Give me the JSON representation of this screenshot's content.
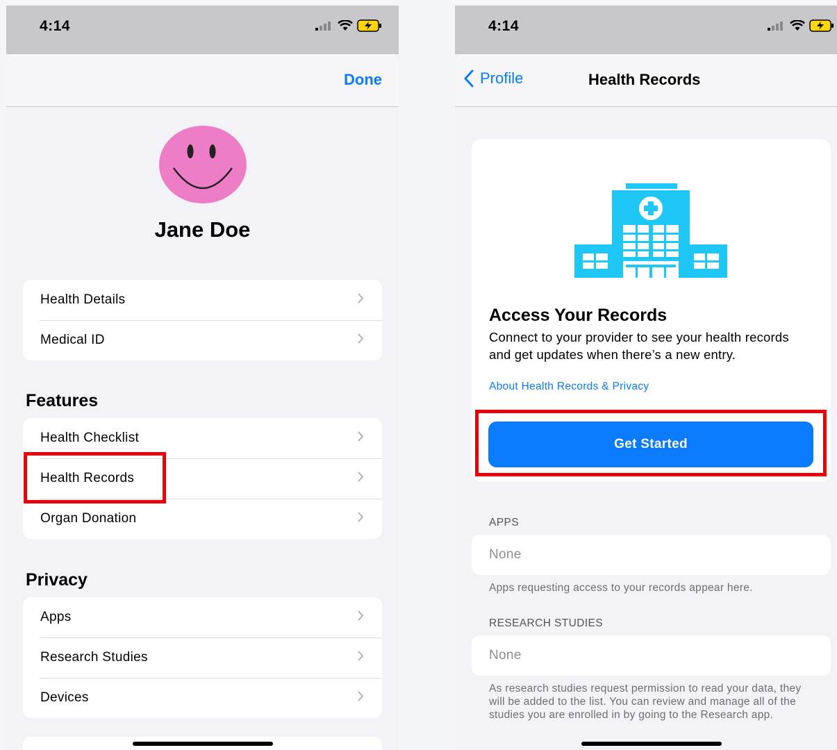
{
  "left": {
    "status": {
      "time": "4:14"
    },
    "nav": {
      "done_label": "Done"
    },
    "profile": {
      "name": "Jane Doe"
    },
    "group1": [
      "Health Details",
      "Medical ID"
    ],
    "features": {
      "title": "Features",
      "items": [
        "Health Checklist",
        "Health Records",
        "Organ Donation"
      ]
    },
    "privacy": {
      "title": "Privacy",
      "items": [
        "Apps",
        "Research Studies",
        "Devices"
      ]
    }
  },
  "right": {
    "status": {
      "time": "4:14"
    },
    "nav": {
      "back_label": "Profile",
      "title": "Health Records"
    },
    "card": {
      "title": "Access Your Records",
      "body": "Connect to your provider to see your health records and get updates when there’s a new entry.",
      "link": "About Health Records & Privacy",
      "button": "Get Started"
    },
    "apps": {
      "header": "APPS",
      "value": "None",
      "footer": "Apps requesting access to your records appear here."
    },
    "research": {
      "header": "RESEARCH STUDIES",
      "value": "None",
      "footer": "As research studies request permission to read your data, they will be added to the list. You can review and manage all of the studies you are enrolled in by going to the Research app."
    }
  },
  "colors": {
    "accent": "#0a7aff",
    "highlight": "#e8000b",
    "avatar": "#ee7dc7",
    "hospital": "#1fc7f6"
  },
  "icons": [
    "signal-icon",
    "wifi-icon",
    "battery-charging-icon",
    "chevron-right-icon",
    "chevron-left-icon",
    "smiley-avatar-icon",
    "hospital-icon"
  ]
}
